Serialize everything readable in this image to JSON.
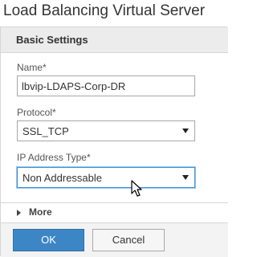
{
  "page": {
    "title": "Load Balancing Virtual Server"
  },
  "panel": {
    "header": "Basic Settings"
  },
  "form": {
    "name": {
      "label": "Name*",
      "value": "lbvip-LDAPS-Corp-DR"
    },
    "protocol": {
      "label": "Protocol*",
      "value": "SSL_TCP"
    },
    "ip_address_type": {
      "label": "IP Address Type*",
      "value": "Non Addressable"
    }
  },
  "more": {
    "label": "More"
  },
  "footer": {
    "ok_label": "OK",
    "cancel_label": "Cancel"
  },
  "colors": {
    "primary_button": "#3d86c6",
    "focus_border": "#3a8fd8",
    "header_bg": "#ececec"
  }
}
